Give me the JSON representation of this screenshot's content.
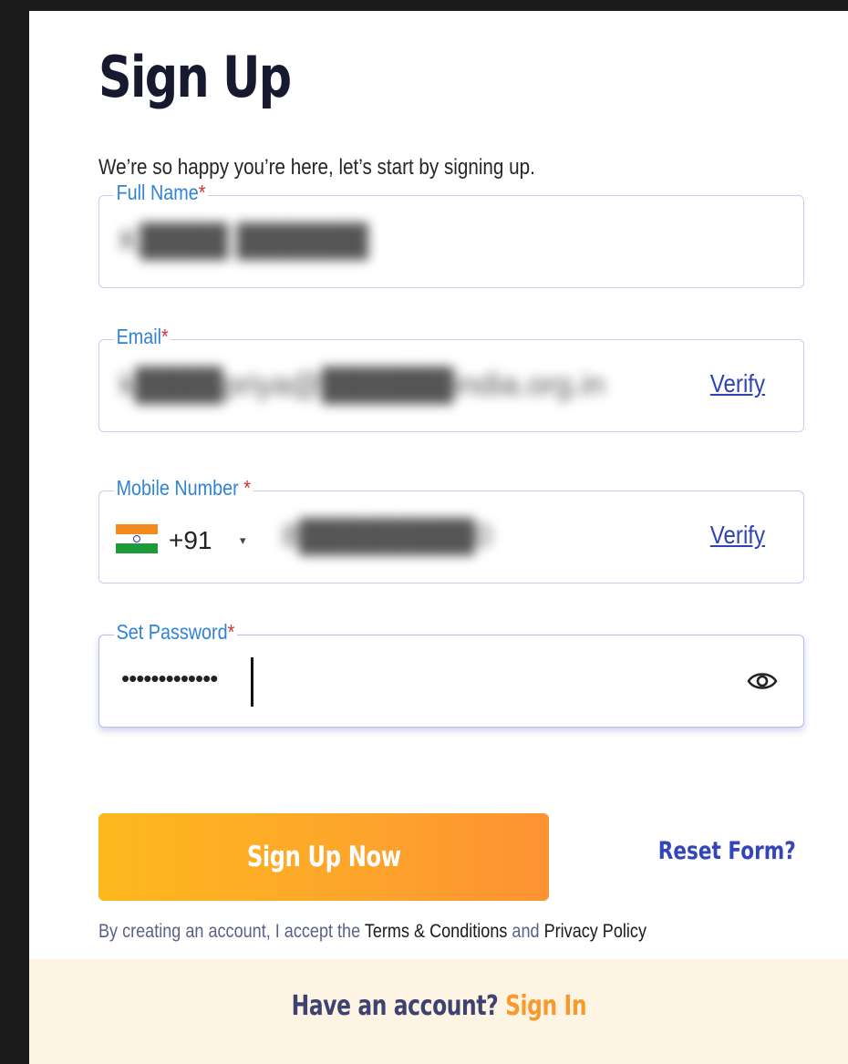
{
  "form": {
    "title": "Sign Up",
    "subtitle": "We’re so happy you’re here, let’s start by signing up."
  },
  "fields": {
    "full_name": {
      "label": "Full Name",
      "required_mark": "*",
      "value_blurred": "K████ ██████"
    },
    "email": {
      "label": "Email",
      "required_mark": "*",
      "value_blurred": "k████priya@██████india.org.in",
      "action": "Verify"
    },
    "mobile": {
      "label": "Mobile Number ",
      "required_mark": "*",
      "country_code": "+91",
      "caret": "▾",
      "value_blurred": "8████████0",
      "action": "Verify",
      "flag_icon": "india-flag-icon"
    },
    "password": {
      "label": "Set Password",
      "required_mark": "*",
      "value": "•••••••••••••",
      "toggle_icon": "eye-icon"
    }
  },
  "actions": {
    "submit": "Sign Up Now",
    "reset": "Reset Form?"
  },
  "terms": {
    "prefix": "By creating an account, I accept the ",
    "terms_link": "Terms & Conditions",
    "and": " and ",
    "privacy_link": "Privacy Policy"
  },
  "footer": {
    "prompt": "Have an account? ",
    "signin": "Sign In"
  },
  "colors": {
    "accent_blue": "#2f83d8",
    "link_blue": "#2e43b4",
    "button_gradient_start": "#fdb81d",
    "button_gradient_end": "#fd9232",
    "footer_bg": "#fdf4e3"
  }
}
